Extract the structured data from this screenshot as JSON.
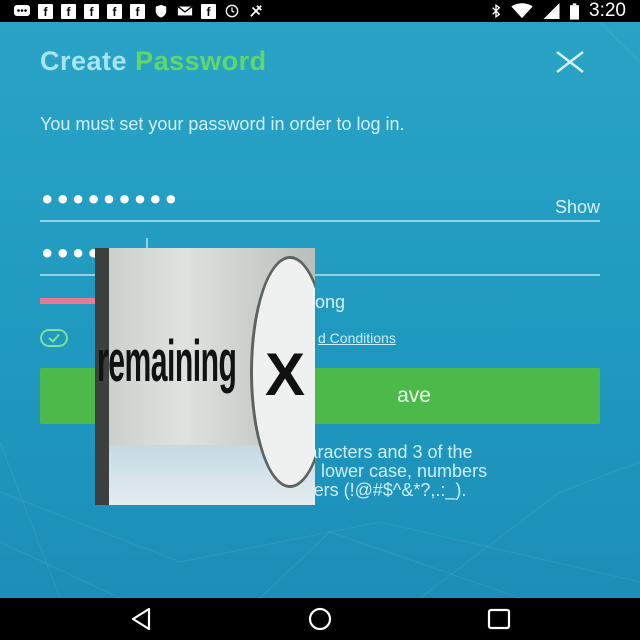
{
  "status_bar": {
    "time": "3:20",
    "icons_left": [
      "chat-icon",
      "facebook-icon",
      "facebook-icon",
      "facebook-icon",
      "facebook-icon",
      "facebook-icon",
      "shield-icon",
      "mail-icon",
      "facebook-icon",
      "clock-icon",
      "satellite-icon"
    ],
    "icons_right": [
      "bluetooth-icon",
      "wifi-icon",
      "signal-icon",
      "battery-icon"
    ],
    "facebook_glyph": "f"
  },
  "screen": {
    "title_part1": "Create",
    "title_part2": "Password",
    "subtitle": "You must set your password in order to log in.",
    "password_field": {
      "value": "•••••••••",
      "toggle_label": "Show"
    },
    "confirm_field": {
      "value": "••••"
    },
    "strength_label": "ong",
    "terms_link": "d Conditions",
    "save_button": "ave",
    "requirements": {
      "line1": "Mu                       aracters and 3 of the",
      "line2": "follo                       e, lower case, numbers",
      "line3": "                           ters (!@#$^&*?,.:_)."
    }
  },
  "overlay": {
    "word": "remaining",
    "close_glyph": "X"
  },
  "colors": {
    "background": "#2099c0",
    "title_create": "#a8e5f3",
    "title_password": "#5fd86a",
    "save_button": "#4cba4a",
    "strength_weak": "#e87a92"
  }
}
